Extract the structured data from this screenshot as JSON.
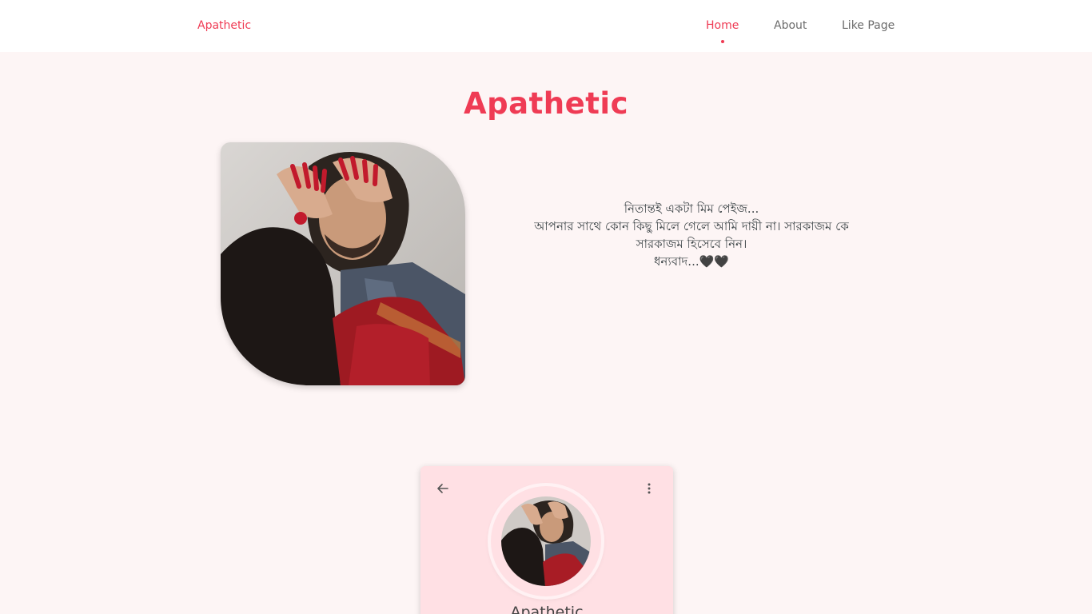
{
  "navbar": {
    "brand": "Apathetic",
    "links": [
      {
        "label": "Home",
        "active": true
      },
      {
        "label": "About",
        "active": false
      },
      {
        "label": "Like Page",
        "active": false
      }
    ]
  },
  "hero": {
    "title": "Apathetic",
    "description_lines": [
      "নিতান্তই একটা মিম পেইজ...",
      "আপনার সাথে কোন কিছু মিলে গেলে আমি দায়ী না। সারকাজম কে",
      "সারকাজম হিসেবে নিন।",
      "ধন্যবাদ...🖤🖤"
    ]
  },
  "profile_card": {
    "name": "Apathetic",
    "back_icon": "arrow-left-icon",
    "menu_icon": "more-vertical-icon"
  },
  "colors": {
    "accent": "#ef3b54",
    "page_bg": "#fdf5f5",
    "card_bg": "#ffe0e4"
  }
}
